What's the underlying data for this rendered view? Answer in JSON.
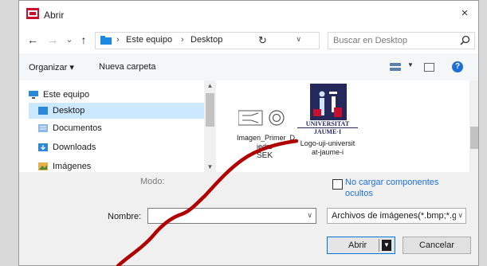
{
  "window": {
    "title": "Abrir",
    "close_glyph": "×"
  },
  "nav": {
    "back_glyph": "←",
    "forward_glyph": "→",
    "recent_glyph": "⌄",
    "up_glyph": "↑",
    "breadcrumb": [
      "Este equipo",
      "Desktop"
    ],
    "separator": "›",
    "search_placeholder": "Buscar en Desktop"
  },
  "toolbar": {
    "organize_label": "Organizar ▾",
    "new_folder_label": "Nueva carpeta",
    "help_label": "?"
  },
  "sidebar": {
    "items": [
      {
        "label": "Este equipo",
        "icon": "computer-icon",
        "selected": false
      },
      {
        "label": "Desktop",
        "icon": "desktop-folder-icon",
        "selected": true
      },
      {
        "label": "Documentos",
        "icon": "documents-icon",
        "selected": false
      },
      {
        "label": "Downloads",
        "icon": "downloads-icon",
        "selected": false
      },
      {
        "label": "Imágenes",
        "icon": "pictures-icon",
        "selected": false
      }
    ]
  },
  "files": [
    {
      "name": "Imagen_Primer_Diedro SEK",
      "line1": "Imagen_Primer_D",
      "line2": "iedro",
      "line3": "SEK",
      "icon": "diedro-thumbnail-icon"
    },
    {
      "name": "Logo-uji-universitat-jaume-i",
      "line1": "Logo-uji-universit",
      "line2": "at-jaume-i",
      "icon": "uji-logo-thumbnail"
    }
  ],
  "logo": {
    "text_top": "UNIVERSITAT",
    "text_bottom": "JAUME·I"
  },
  "bottom": {
    "modo_label": "Modo:",
    "hidden_checkbox_label": "No cargar componentes ocultos",
    "filename_label": "Nombre:",
    "filename_value": "",
    "filter_value": "Archivos de imágenes(*.bmp;*.g",
    "open_label": "Abrir",
    "cancel_label": "Cancelar"
  },
  "colors": {
    "accent": "#0078d7",
    "link": "#1e70d6",
    "selection": "#cce8ff",
    "scribble": "#b00000"
  }
}
